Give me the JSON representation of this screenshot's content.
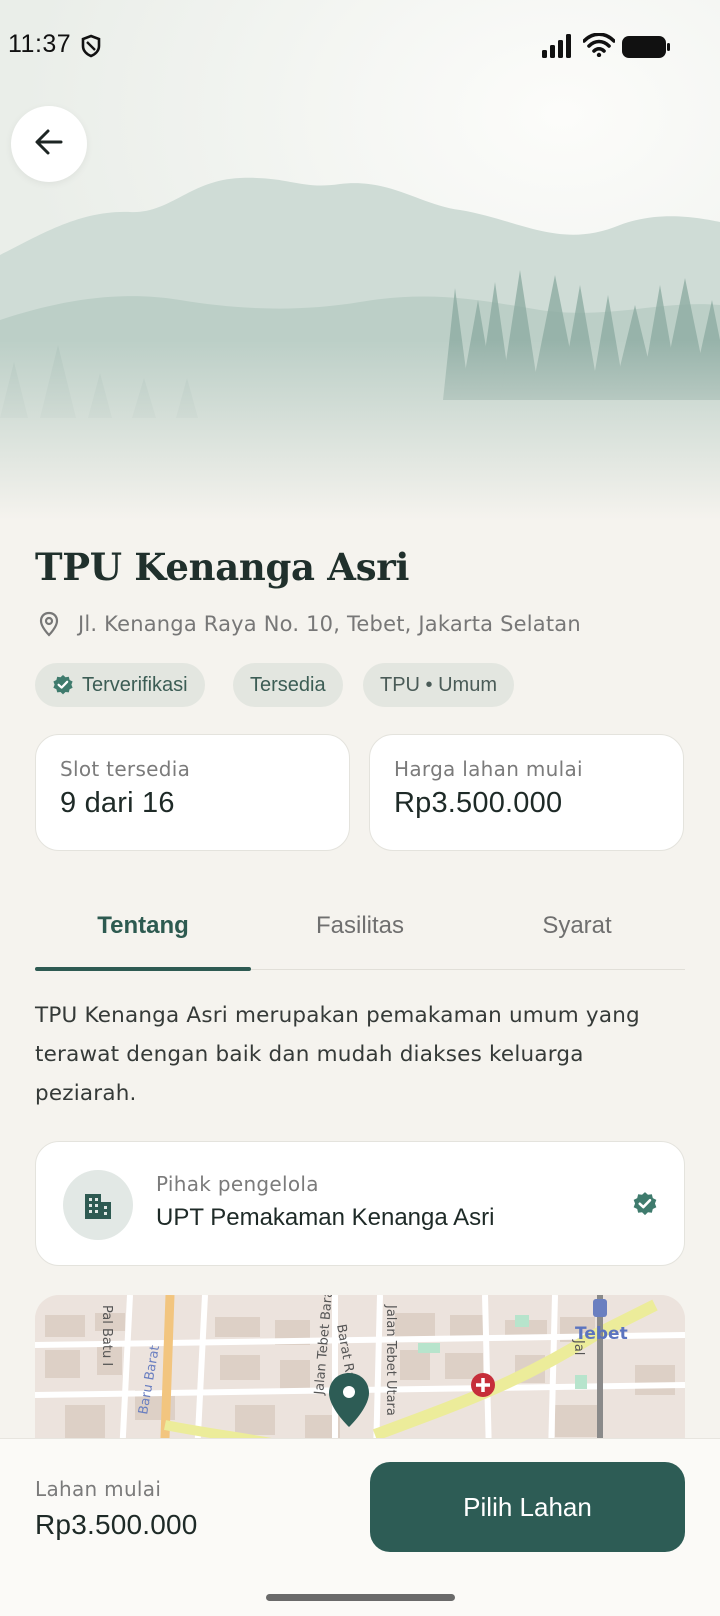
{
  "status_bar": {
    "time": "11:37"
  },
  "header": {
    "back_icon": "arrow-left-icon"
  },
  "place": {
    "title": "TPU Kenanga Asri",
    "address": "Jl. Kenanga Raya No. 10, Tebet, Jakarta Selatan",
    "chips": {
      "verified": "Terverifikasi",
      "available": "Tersedia",
      "type": "TPU • Umum"
    }
  },
  "stats": {
    "slot_label": "Slot tersedia",
    "slot_value": "9 dari 16",
    "price_label": "Harga lahan mulai",
    "price_value": "Rp3.500.000"
  },
  "tabs": {
    "items": [
      "Tentang",
      "Fasilitas",
      "Syarat"
    ],
    "active": "Tentang"
  },
  "about_text": "TPU Kenanga Asri merupakan pemakaman umum yang terawat dengan baik dan mudah diakses keluarga peziarah.",
  "manager": {
    "label": "Pihak pengelola",
    "name": "UPT Pemakaman Kenanga Asri"
  },
  "map": {
    "labels": [
      "Pal Batu I",
      "Jalan Tebet Utara",
      "Barat Raya",
      "Tebet",
      "Baru Barat",
      "Jalan Tebet Barat",
      "Jal"
    ]
  },
  "bottom_bar": {
    "label": "Lahan mulai",
    "price": "Rp3.500.000",
    "cta": "Pilih Lahan"
  },
  "colors": {
    "accent": "#2d5c55",
    "background": "#f5f3ee",
    "chip_bg": "#e3e6e0"
  }
}
